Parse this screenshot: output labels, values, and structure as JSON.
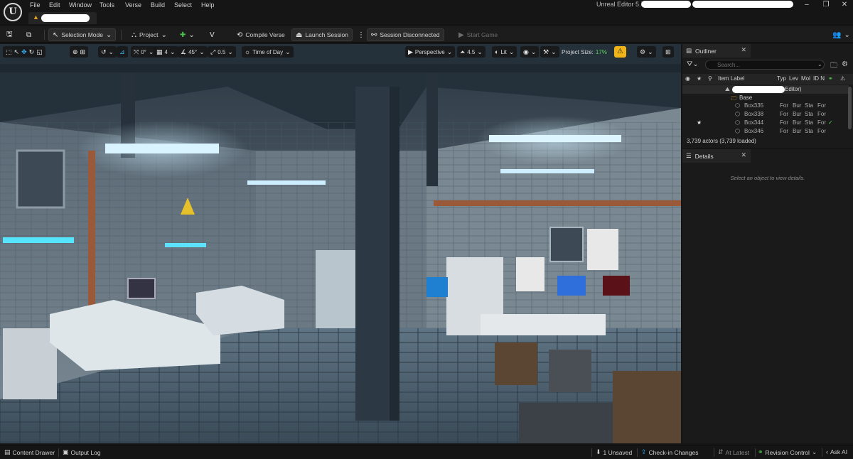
{
  "menu": {
    "items": [
      "File",
      "Edit",
      "Window",
      "Tools",
      "Verse",
      "Build",
      "Select",
      "Help"
    ],
    "editor_title": "Unreal Editor 5.7 -",
    "window_controls": [
      "–",
      "❐",
      "✕"
    ]
  },
  "toolbar": {
    "selection_mode": "Selection Mode",
    "project": "Project",
    "compile_verse": "Compile Verse",
    "launch_session": "Launch Session",
    "session_status": "Session Disconnected",
    "start_game": "Start Game"
  },
  "viewport_toolbar": {
    "rotation_value": "0°",
    "grid_value": "4",
    "angle_value": "45°",
    "scale_value": "0.5",
    "time_of_day": "Time of Day",
    "perspective": "Perspective",
    "camera_speed": "4.5",
    "view_mode": "Lit",
    "project_size_label": "Project Size:",
    "project_size_value": "17%"
  },
  "outliner": {
    "title": "Outliner",
    "search_placeholder": "Search...",
    "columns": {
      "item_label": "Item Label",
      "type": "Typ",
      "level": "Lev",
      "mobility": "Mol",
      "id": "ID N"
    },
    "level_suffix": "Editor)",
    "rows": [
      {
        "label": "Base",
        "cols": [
          "",
          "",
          "",
          ""
        ],
        "star": "",
        "check": ""
      },
      {
        "label": "Box335",
        "cols": [
          "For",
          "Bur",
          "Sta",
          "For"
        ],
        "star": "",
        "check": ""
      },
      {
        "label": "Box338",
        "cols": [
          "For",
          "Bur",
          "Sta",
          "For"
        ],
        "star": "",
        "check": ""
      },
      {
        "label": "Box344",
        "cols": [
          "For",
          "Bur",
          "Sta",
          "For"
        ],
        "star": "★",
        "check": "✓"
      },
      {
        "label": "Box346",
        "cols": [
          "For",
          "Bur",
          "Sta",
          "For"
        ],
        "star": "",
        "check": ""
      }
    ],
    "actor_count": "3,739 actors (3,739 loaded)"
  },
  "details": {
    "title": "Details",
    "empty_message": "Select an object to view details."
  },
  "statusbar": {
    "content_drawer": "Content Drawer",
    "output_log": "Output Log",
    "unsaved": "1 Unsaved",
    "checkin": "Check-in Changes",
    "at_latest": "At Latest",
    "revision_control": "Revision Control",
    "ask_ai": "Ask AI"
  },
  "colors": {
    "accent": "#35b6ff",
    "project_size_ok": "#5fd35f",
    "warning": "#f0b418"
  }
}
